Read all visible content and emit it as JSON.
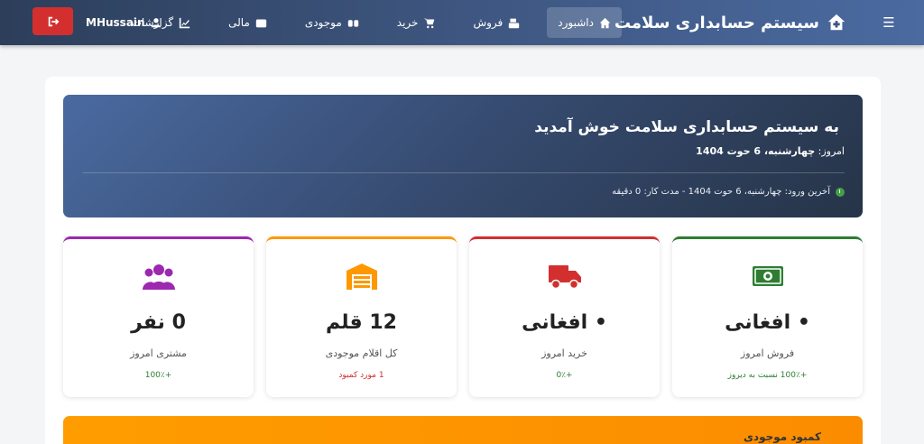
{
  "nav": {
    "brand": "سیستم حسابداری سلامت",
    "items": [
      {
        "label": "داشبورد",
        "icon": "home-icon"
      },
      {
        "label": "فروش",
        "icon": "register-icon"
      },
      {
        "label": "خرید",
        "icon": "cart-icon"
      },
      {
        "label": "موجودی",
        "icon": "boxes-icon"
      },
      {
        "label": "مالی",
        "icon": "wallet-icon"
      },
      {
        "label": "گزارشات",
        "icon": "chart-icon"
      }
    ],
    "user": "MHussain"
  },
  "welcome": {
    "title": "به سیستم حسابداری سلامت خوش آمدید",
    "date_prefix": "امروز:",
    "date_value": "چهارشنبه، 6 حوت 1404",
    "last_login": "آخرین ورود: چهارشنبه، 6 حوت 1404 - مدت کار: 0 دقیقه"
  },
  "cards": [
    {
      "value": "0 نفر",
      "label": "مشتری امروز",
      "sub": "+100٪",
      "color": "#9c27b0",
      "sub_color": "#2e7d32"
    },
    {
      "value": "12 قلم",
      "label": "کل اقلام موجودی",
      "sub": "1 مورد کمبود",
      "color": "#ff9800",
      "sub_color": "#d32f2f"
    },
    {
      "value": "• افغانی",
      "label": "خرید امروز",
      "sub": "+0٪",
      "color": "#d32f2f",
      "sub_color": "#2e7d32"
    },
    {
      "value": "• افغانی",
      "label": "فروش امروز",
      "sub": "+100٪ نسبت به دیروز",
      "color": "#2e7d32",
      "sub_color": "#2e7d32"
    }
  ],
  "alert": {
    "title": "کمبود موجودی"
  }
}
